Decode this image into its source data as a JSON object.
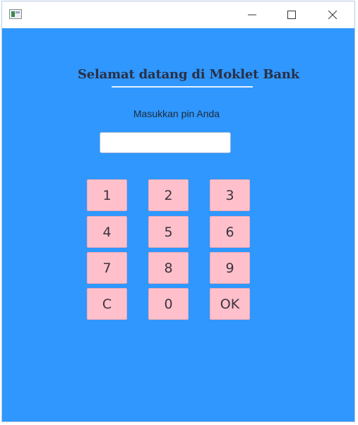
{
  "window": {
    "title": ""
  },
  "header": {
    "title": "Selamat datang di Moklet Bank"
  },
  "pin": {
    "prompt": "Masukkan pin Anda",
    "value": ""
  },
  "keypad": {
    "keys": [
      "1",
      "2",
      "3",
      "4",
      "5",
      "6",
      "7",
      "8",
      "9",
      "C",
      "0",
      "OK"
    ]
  },
  "colors": {
    "background": "#2f97fd",
    "key": "#ffc0cb",
    "title_text": "#2a2f45"
  }
}
